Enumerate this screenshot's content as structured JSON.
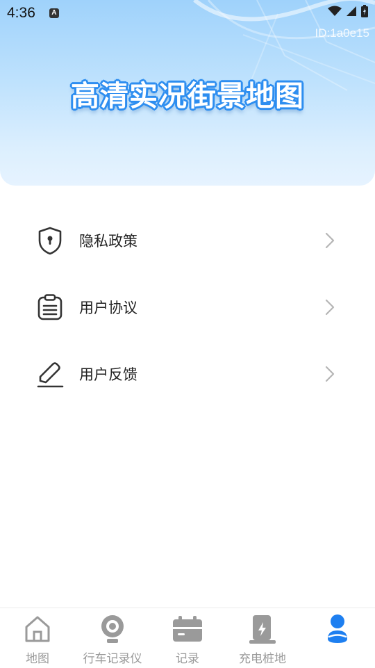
{
  "status_bar": {
    "time": "4:36",
    "notification_letter": "A"
  },
  "header": {
    "device_id": "ID:1a0e15",
    "title": "高清实况街景地图"
  },
  "menu": {
    "items": [
      {
        "label": "隐私政策",
        "icon": "shield-lock-icon"
      },
      {
        "label": "用户协议",
        "icon": "clipboard-icon"
      },
      {
        "label": "用户反馈",
        "icon": "pencil-icon"
      }
    ]
  },
  "bottom_nav": {
    "items": [
      {
        "label": "地图",
        "icon": "home-icon",
        "active": false
      },
      {
        "label": "行车记录仪",
        "icon": "webcam-icon",
        "active": false
      },
      {
        "label": "记录",
        "icon": "calendar-icon",
        "active": false
      },
      {
        "label": "充电桩地",
        "icon": "charging-pile-icon",
        "active": false
      },
      {
        "label": "",
        "icon": "user-icon",
        "active": true
      }
    ]
  },
  "colors": {
    "accent": "#2e8ef0",
    "nav_inactive": "#9a9a9a",
    "nav_active": "#1e7ff0"
  }
}
